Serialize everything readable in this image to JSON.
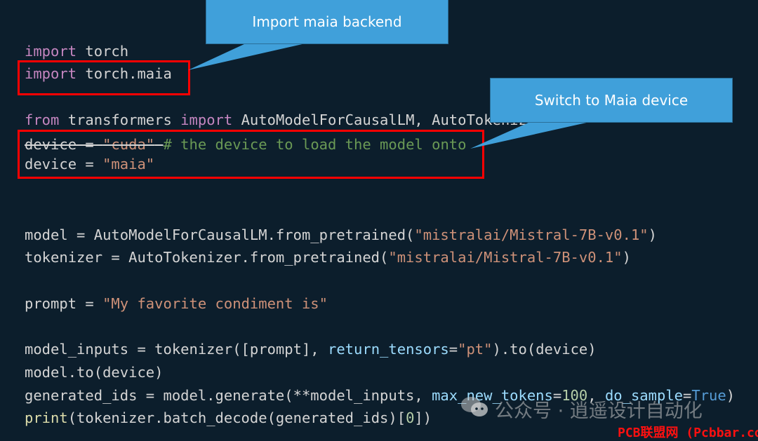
{
  "editor": {
    "theme_colors": {
      "background": "#0c1e2c",
      "keyword": "#c586c0",
      "string": "#ce9178",
      "comment": "#6a9955",
      "parameter": "#9cdcfe",
      "number": "#b5cea8",
      "constant": "#569cd6",
      "function": "#dcdcaa",
      "highlight_box": "#ff0000",
      "callout": "#40a0da"
    },
    "lines": {
      "l1": {
        "kw": "import",
        "rest": " torch"
      },
      "l2": {
        "kw": "import",
        "rest": " torch.maia"
      },
      "l3": {
        "kw1": "from",
        "mid": " transformers ",
        "kw2": "import",
        "rest": " AutoModelForCausalLM, AutoTokenizer"
      },
      "l4": {
        "a": "device = ",
        "b": "\"cuda\"",
        "c": " ",
        "comment": "# the device to load the model onto"
      },
      "l5": {
        "a": "device = ",
        "b": "\"maia\""
      },
      "l6": {
        "a": "model = AutoModelForCausalLM.from_pretrained(",
        "b": "\"mistralai/Mistral-7B-v0.1\"",
        "c": ")"
      },
      "l7": {
        "a": "tokenizer = AutoTokenizer.from_pretrained(",
        "b": "\"mistralai/Mistral-7B-v0.1\"",
        "c": ")"
      },
      "l8": {
        "a": "prompt = ",
        "b": "\"My favorite condiment is\""
      },
      "l9": {
        "a": "model_inputs = tokenizer([prompt], ",
        "p": "return_tensors",
        "eq": "=",
        "b": "\"pt\"",
        "c": ").to(device)"
      },
      "l10": {
        "a": "model.to(device)"
      },
      "l11": {
        "a": "generated_ids = model.generate(**model_inputs, ",
        "p1": "max_new_tokens",
        "eq1": "=",
        "n": "100",
        "sep": ", ",
        "p2": "do_sample",
        "eq2": "=",
        "k": "True",
        "c": ")"
      },
      "l12": {
        "fn": "print",
        "a": "(tokenizer.batch_decode(generated_ids)[",
        "n": "0",
        "c": "])"
      }
    }
  },
  "callouts": {
    "import_backend": "Import maia backend",
    "switch_device": "Switch to Maia device"
  },
  "watermarks": {
    "wechat": "公众号 · 逍遥设计自动化",
    "site": "PCB联盟网 (Pcbbar.com)"
  }
}
